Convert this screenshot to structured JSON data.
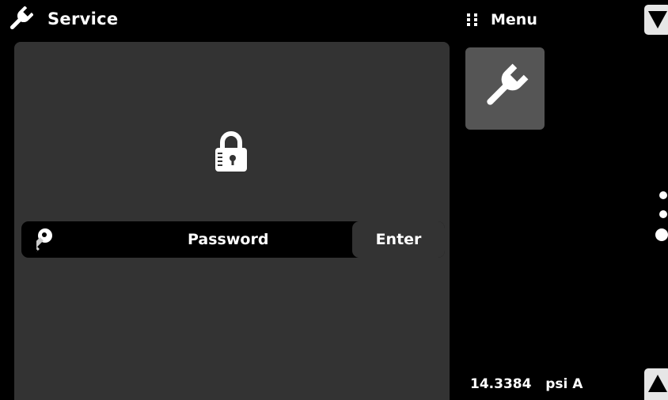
{
  "header": {
    "title": "Service",
    "icon": "wrench-icon"
  },
  "password_row": {
    "icon": "key-icon",
    "label": "Password",
    "enter_label": "Enter"
  },
  "lock": {
    "icon": "lock-icon"
  },
  "menu": {
    "label": "Menu",
    "icon": "grid-dots-icon"
  },
  "side_panel": {
    "tiles": [
      {
        "icon": "wrench-icon"
      }
    ],
    "page_indicator": {
      "icon": "page-dots-icon"
    }
  },
  "status": {
    "pressure_value": "14.3384",
    "pressure_unit": "psi A"
  },
  "colors": {
    "background": "#000000",
    "panel": "#333333",
    "tile": "#555555",
    "text": "#ffffff",
    "scroll_button": "#e6e6e6"
  }
}
